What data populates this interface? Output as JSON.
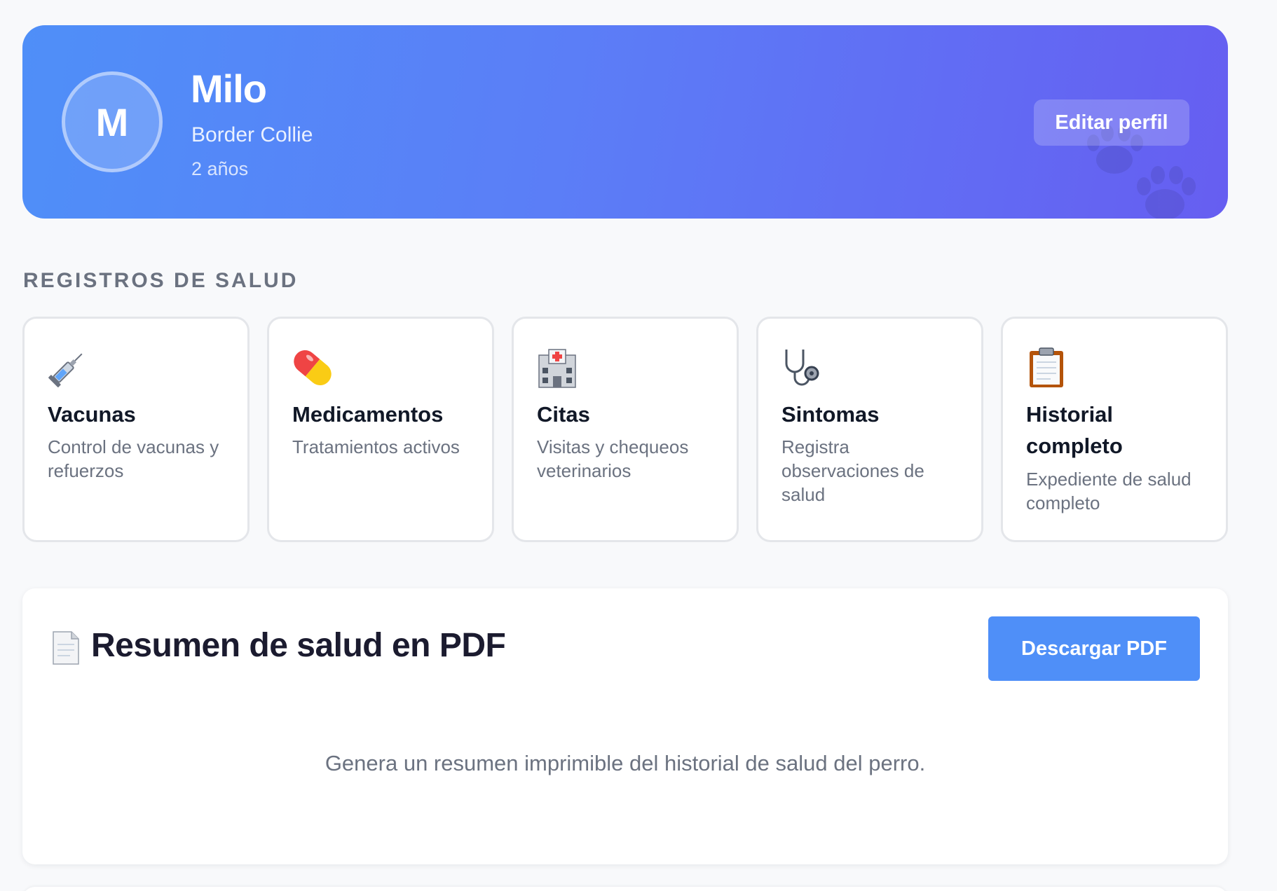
{
  "profile": {
    "initial": "M",
    "name": "Milo",
    "breed": "Border Collie",
    "age": "2 años",
    "edit_label": "Editar perfil",
    "gradient_start": "#4f8ff8",
    "gradient_end": "#665ef1"
  },
  "health_records": {
    "section_title": "REGISTROS DE SALUD",
    "tiles": [
      {
        "icon": "syringe-icon",
        "title": "Vacunas",
        "description": "Control de vacunas y refuerzos"
      },
      {
        "icon": "pill-icon",
        "title": "Medicamentos",
        "description": "Tratamientos activos"
      },
      {
        "icon": "hospital-icon",
        "title": "Citas",
        "description": "Visitas y chequeos veterinarios"
      },
      {
        "icon": "stethoscope-icon",
        "title": "Sintomas",
        "description": "Registra observaciones de salud"
      },
      {
        "icon": "clipboard-icon",
        "title": "Historial completo",
        "description": "Expediente de salud completo"
      }
    ]
  },
  "pdf_summary": {
    "icon": "document-icon",
    "title": "Resumen de salud en PDF",
    "button_label": "Descargar PDF",
    "description": "Genera un resumen imprimible del historial de salud del perro.",
    "accent": "#4f8ff8"
  }
}
